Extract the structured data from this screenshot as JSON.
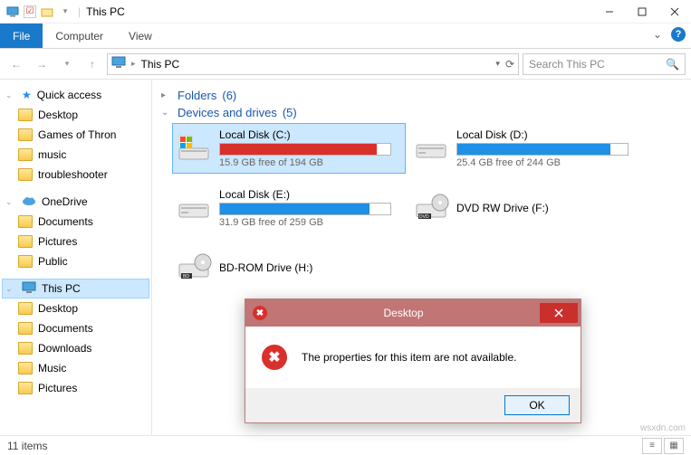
{
  "window": {
    "title": "This PC",
    "tabs": {
      "file": "File",
      "computer": "Computer",
      "view": "View"
    }
  },
  "nav": {
    "path": "This PC",
    "search_placeholder": "Search This PC"
  },
  "sidebar": {
    "quick_access": {
      "label": "Quick access",
      "items": [
        "Desktop",
        "Games of Thron",
        "music",
        "troubleshooter"
      ]
    },
    "onedrive": {
      "label": "OneDrive",
      "items": [
        "Documents",
        "Pictures",
        "Public"
      ]
    },
    "this_pc": {
      "label": "This PC",
      "items": [
        "Desktop",
        "Documents",
        "Downloads",
        "Music",
        "Pictures"
      ]
    }
  },
  "groups": {
    "folders": {
      "label": "Folders",
      "count": "(6)"
    },
    "devices": {
      "label": "Devices and drives",
      "count": "(5)"
    }
  },
  "drives": [
    {
      "name": "Local Disk (C:)",
      "free_text": "15.9 GB free of 194 GB",
      "fill_pct": 92,
      "color": "#d9302c",
      "selected": true,
      "kind": "hdd-win"
    },
    {
      "name": "Local Disk (D:)",
      "free_text": "25.4 GB free of 244 GB",
      "fill_pct": 90,
      "color": "#1e90e6",
      "selected": false,
      "kind": "hdd"
    },
    {
      "name": "Local Disk (E:)",
      "free_text": "31.9 GB free of 259 GB",
      "fill_pct": 88,
      "color": "#1e90e6",
      "selected": false,
      "kind": "hdd"
    },
    {
      "name": "DVD RW Drive (F:)",
      "free_text": "",
      "fill_pct": 0,
      "color": "",
      "selected": false,
      "kind": "dvd"
    },
    {
      "name": "BD-ROM Drive (H:)",
      "free_text": "",
      "fill_pct": 0,
      "color": "",
      "selected": false,
      "kind": "bd"
    }
  ],
  "status": {
    "items": "11 items"
  },
  "dialog": {
    "title": "Desktop",
    "message": "The properties for this item are not available.",
    "ok": "OK"
  },
  "watermark": "wsxdn.com"
}
